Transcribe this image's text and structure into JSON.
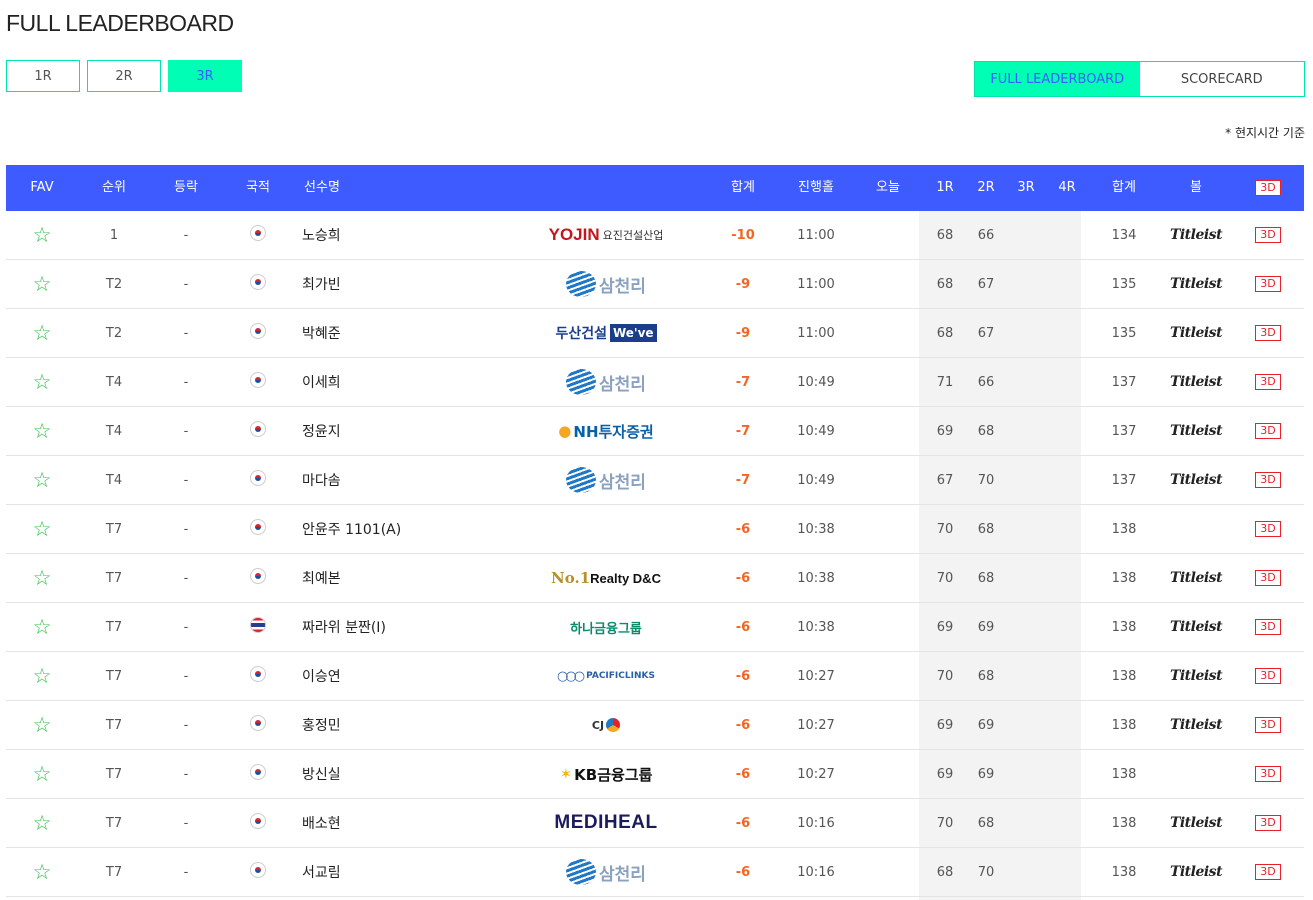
{
  "page": {
    "title": "FULL LEADERBOARD",
    "note": "* 현지시간 기준"
  },
  "round_tabs": [
    {
      "label": "1R"
    },
    {
      "label": "2R"
    },
    {
      "label": "3R"
    }
  ],
  "view_tabs": [
    {
      "label": "FULL LEADERBOARD"
    },
    {
      "label": "SCORECARD"
    }
  ],
  "columns": {
    "fav": "FAV",
    "rank": "순위",
    "move": "등락",
    "nation": "국적",
    "name": "선수명",
    "total": "합계",
    "progress": "진행홀",
    "today": "오늘",
    "r1": "1R",
    "r2": "2R",
    "r3": "3R",
    "r4": "4R",
    "strokes": "합계",
    "ball": "볼",
    "view3d": "3D"
  },
  "colors": {
    "header_bg": "#3d5bff",
    "accent": "#00ffb4",
    "score": "#f26522",
    "star": "#2fbf4a"
  },
  "rows": [
    {
      "rank": "1",
      "move": "-",
      "flag": "kr",
      "name": "노승희",
      "sponsor": "YOJIN",
      "sponsor_sub": "요진건설산업",
      "sponsor_style": "yojin",
      "total": "-10",
      "progress": "11:00",
      "r1": "68",
      "r2": "66",
      "strokes": "134",
      "ball": "Titleist",
      "btn": "3D"
    },
    {
      "rank": "T2",
      "move": "-",
      "flag": "kr",
      "name": "최가빈",
      "sponsor": "삼천리",
      "sponsor_sub": "",
      "sponsor_style": "sam",
      "total": "-9",
      "progress": "11:00",
      "r1": "68",
      "r2": "67",
      "strokes": "135",
      "ball": "Titleist",
      "btn": "3D"
    },
    {
      "rank": "T2",
      "move": "-",
      "flag": "kr",
      "name": "박혜준",
      "sponsor": "두산건설",
      "sponsor_sub": "We've",
      "sponsor_style": "doosan",
      "total": "-9",
      "progress": "11:00",
      "r1": "68",
      "r2": "67",
      "strokes": "135",
      "ball": "Titleist",
      "btn": "3D"
    },
    {
      "rank": "T4",
      "move": "-",
      "flag": "kr",
      "name": "이세희",
      "sponsor": "삼천리",
      "sponsor_sub": "",
      "sponsor_style": "sam",
      "total": "-7",
      "progress": "10:49",
      "r1": "71",
      "r2": "66",
      "strokes": "137",
      "ball": "Titleist",
      "btn": "3D"
    },
    {
      "rank": "T4",
      "move": "-",
      "flag": "kr",
      "name": "정윤지",
      "sponsor": "NH투자증권",
      "sponsor_sub": "",
      "sponsor_style": "nh",
      "total": "-7",
      "progress": "10:49",
      "r1": "69",
      "r2": "68",
      "strokes": "137",
      "ball": "Titleist",
      "btn": "3D"
    },
    {
      "rank": "T4",
      "move": "-",
      "flag": "kr",
      "name": "마다솜",
      "sponsor": "삼천리",
      "sponsor_sub": "",
      "sponsor_style": "sam",
      "total": "-7",
      "progress": "10:49",
      "r1": "67",
      "r2": "70",
      "strokes": "137",
      "ball": "Titleist",
      "btn": "3D"
    },
    {
      "rank": "T7",
      "move": "-",
      "flag": "kr",
      "name": "안윤주 1101(A)",
      "sponsor": "",
      "sponsor_sub": "",
      "sponsor_style": "none",
      "total": "-6",
      "progress": "10:38",
      "r1": "70",
      "r2": "68",
      "strokes": "138",
      "ball": "",
      "btn": "3D"
    },
    {
      "rank": "T7",
      "move": "-",
      "flag": "kr",
      "name": "최예본",
      "sponsor": "No.1",
      "sponsor_sub": "Realty D&C",
      "sponsor_style": "no1",
      "total": "-6",
      "progress": "10:38",
      "r1": "70",
      "r2": "68",
      "strokes": "138",
      "ball": "Titleist",
      "btn": "3D"
    },
    {
      "rank": "T7",
      "move": "-",
      "flag": "th",
      "name": "짜라위 분짠(I)",
      "sponsor": "하나금융그룹",
      "sponsor_sub": "",
      "sponsor_style": "hana",
      "total": "-6",
      "progress": "10:38",
      "r1": "69",
      "r2": "69",
      "strokes": "138",
      "ball": "Titleist",
      "btn": "3D"
    },
    {
      "rank": "T7",
      "move": "-",
      "flag": "kr",
      "name": "이승연",
      "sponsor": "PACIFICLINKS",
      "sponsor_sub": "",
      "sponsor_style": "pacific",
      "total": "-6",
      "progress": "10:27",
      "r1": "70",
      "r2": "68",
      "strokes": "138",
      "ball": "Titleist",
      "btn": "3D"
    },
    {
      "rank": "T7",
      "move": "-",
      "flag": "kr",
      "name": "홍정민",
      "sponsor": "CJ",
      "sponsor_sub": "",
      "sponsor_style": "cj",
      "total": "-6",
      "progress": "10:27",
      "r1": "69",
      "r2": "69",
      "strokes": "138",
      "ball": "Titleist",
      "btn": "3D"
    },
    {
      "rank": "T7",
      "move": "-",
      "flag": "kr",
      "name": "방신실",
      "sponsor": "KB금융그룹",
      "sponsor_sub": "",
      "sponsor_style": "kb",
      "total": "-6",
      "progress": "10:27",
      "r1": "69",
      "r2": "69",
      "strokes": "138",
      "ball": "",
      "btn": "3D"
    },
    {
      "rank": "T7",
      "move": "-",
      "flag": "kr",
      "name": "배소현",
      "sponsor": "MEDIHEAL",
      "sponsor_sub": "",
      "sponsor_style": "medi",
      "total": "-6",
      "progress": "10:16",
      "r1": "70",
      "r2": "68",
      "strokes": "138",
      "ball": "Titleist",
      "btn": "3D"
    },
    {
      "rank": "T7",
      "move": "-",
      "flag": "kr",
      "name": "서교림",
      "sponsor": "삼천리",
      "sponsor_sub": "",
      "sponsor_style": "sam",
      "total": "-6",
      "progress": "10:16",
      "r1": "68",
      "r2": "70",
      "strokes": "138",
      "ball": "Titleist",
      "btn": "3D"
    }
  ]
}
